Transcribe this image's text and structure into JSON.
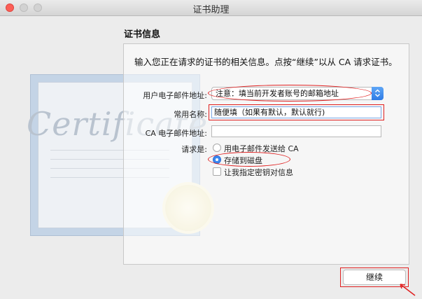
{
  "window": {
    "title": "证书助理"
  },
  "heading": "证书信息",
  "instruction": "输入您正在请求的证书的相关信息。点按“继续”以从 CA 请求证书。",
  "artwork": {
    "certificate_word": "Certificate"
  },
  "form": {
    "email_label": "用户电子邮件地址:",
    "email_value": "注意：填当前开发者账号的邮箱地址",
    "common_name_label": "常用名称:",
    "common_name_value": "随便填（如果有默认，默认就行)",
    "ca_email_label": "CA 电子邮件地址:",
    "ca_email_value": "",
    "request_label": "请求是:",
    "options": [
      {
        "label": "用电子邮件发送给 CA",
        "selected": false
      },
      {
        "label": "存储到磁盘",
        "selected": true
      }
    ],
    "custom_key_label": "让我指定密钥对信息",
    "custom_key_checked": false
  },
  "buttons": {
    "continue": "继续"
  },
  "colors": {
    "annotation": "#e02020",
    "accent": "#3b87ef",
    "close": "#fc5f57"
  }
}
